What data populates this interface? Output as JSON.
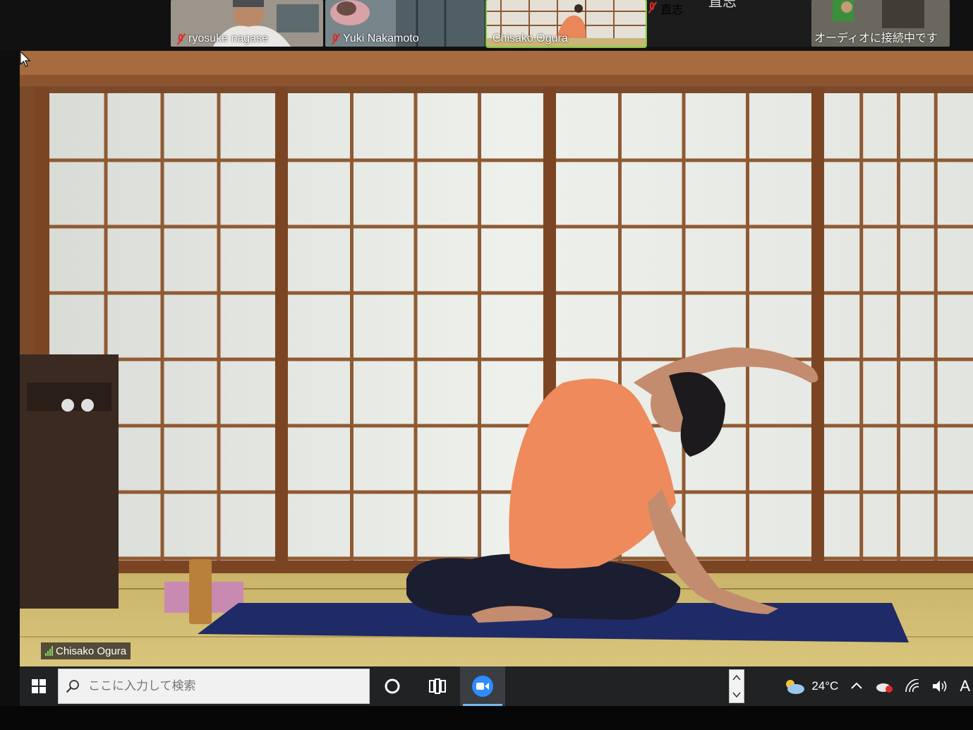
{
  "participants": [
    {
      "name": "ryosuke nagase",
      "muted": true
    },
    {
      "name": "Yuki Nakamoto",
      "muted": true
    },
    {
      "name": "Chisako Ogura",
      "muted": false,
      "active": true
    },
    {
      "name": "直志",
      "muted": true,
      "initials": "直志"
    },
    {
      "name": "オーディオに接続中です"
    }
  ],
  "main_video": {
    "speaker_name": "Chisako Ogura"
  },
  "taskbar": {
    "search_placeholder": "ここに入力して検索",
    "weather_temp": "24°C",
    "ime_indicator": "A"
  },
  "icons": [
    "windows-logo",
    "search-icon",
    "cortana-icon",
    "task-view-icon",
    "zoom-icon",
    "weather-icon",
    "chevron-up-icon",
    "onedrive-icon",
    "wifi-icon",
    "volume-icon",
    "signal-icon"
  ]
}
